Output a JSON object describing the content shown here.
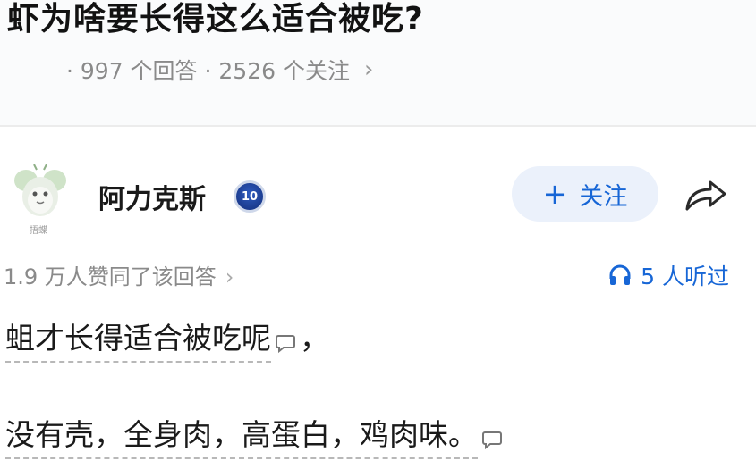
{
  "question": {
    "title": "虾为啥要长得这么适合被吃?",
    "meta": "· 997 个回答 · 2526 个关注",
    "meta_chevron": "›"
  },
  "author": {
    "name": "阿力克斯",
    "avatar_caption": "捂蝶",
    "badge": "10",
    "follow_plus": "+",
    "follow_label": "关注"
  },
  "stats": {
    "approval": "1.9 万人赞同了该回答",
    "approval_chevron": "›",
    "listened": "5 人听过"
  },
  "answer": {
    "line1_text": "蛆才长得适合被吃呢",
    "line1_tail": "，",
    "line2_text": "没有壳，全身肉，高蛋白，鸡肉味。"
  },
  "colors": {
    "accent": "#1766d6",
    "follow_bg": "#ebf1fb",
    "meta_gray": "#8a8a8a"
  },
  "icons": {
    "share": "share-arrow-icon",
    "headphone": "headphone-icon",
    "comment": "comment-bubble-icon",
    "badge": "level-badge-icon"
  }
}
